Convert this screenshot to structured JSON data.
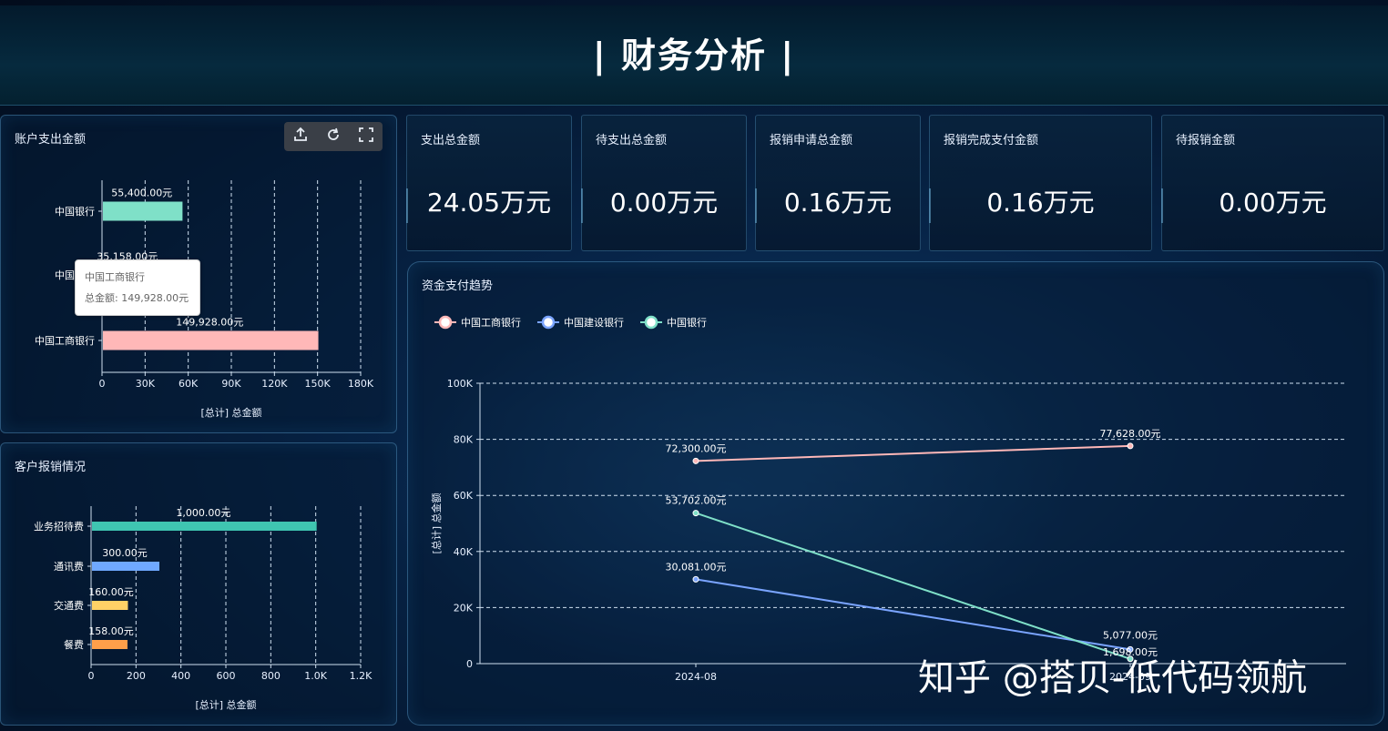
{
  "header": {
    "title": "| 财务分析 |"
  },
  "watermark": "知乎 @搭贝-低代码领航",
  "toolbar": {
    "icons": [
      "export-icon",
      "refresh-icon",
      "fullscreen-icon"
    ]
  },
  "colors": {
    "icbc": "#ffb8b8",
    "ccb": "#7aa4ff",
    "boc": "#7fe0c8",
    "bar1": "#3fc5b1",
    "bar2": "#6fa8ff",
    "bar3": "#ffd166",
    "bar4": "#ff9f4a"
  },
  "kpis": [
    {
      "label": "支出总金额",
      "value": "24.05万元"
    },
    {
      "label": "待支出总金额",
      "value": "0.00万元"
    },
    {
      "label": "报销申请总金额",
      "value": "0.16万元"
    },
    {
      "label": "报销完成支付金额",
      "value": "0.16万元"
    },
    {
      "label": "待报销金额",
      "value": "0.00万元"
    }
  ],
  "tooltip": {
    "title": "中国工商银行",
    "line": "总金额: 149,928.00元"
  },
  "chart_data": [
    {
      "type": "bar",
      "title": "账户支出金额",
      "orientation": "horizontal",
      "categories": [
        "中国银行",
        "中国建设银行",
        "中国工商银行"
      ],
      "category_labels": [
        "中国银行",
        "中国建设",
        "中国工商银行"
      ],
      "values": [
        55400,
        35158,
        149928
      ],
      "value_labels": [
        "55,400.00元",
        "35,158.00元",
        "149,928.00元"
      ],
      "xlim": [
        0,
        180000
      ],
      "xticks": [
        "0",
        "30K",
        "60K",
        "90K",
        "120K",
        "150K",
        "180K"
      ],
      "xlabel": "[总计] 总金额",
      "grid": true
    },
    {
      "type": "bar",
      "title": "客户报销情况",
      "orientation": "horizontal",
      "categories": [
        "业务招待费",
        "通讯费",
        "交通费",
        "餐费"
      ],
      "values": [
        1000,
        300,
        160,
        158
      ],
      "value_labels": [
        "1,000.00元",
        "300.00元",
        "160.00元",
        "158.00元"
      ],
      "xlim": [
        0,
        1200
      ],
      "xticks": [
        "0",
        "200",
        "400",
        "600",
        "800",
        "1.0K",
        "1.2K"
      ],
      "xlabel": "[总计] 总金额",
      "grid": true
    },
    {
      "type": "line",
      "title": "资金支付趋势",
      "x": [
        "2024-08",
        "2024-09"
      ],
      "series": [
        {
          "name": "中国工商银行",
          "values": [
            72300,
            77628
          ],
          "labels": [
            "72,300.00元",
            "77,628.00元"
          ]
        },
        {
          "name": "中国建设银行",
          "values": [
            30081,
            5077
          ],
          "labels": [
            "30,081.00元",
            "5,077.00元"
          ]
        },
        {
          "name": "中国银行",
          "values": [
            53702,
            1698
          ],
          "labels": [
            "53,702.00元",
            "1,698.00元"
          ]
        }
      ],
      "ylim": [
        0,
        100000
      ],
      "yticks": [
        "0",
        "20K",
        "40K",
        "60K",
        "80K",
        "100K"
      ],
      "ylabel": "[总计] 总金额",
      "legend": "top-left",
      "grid": true
    }
  ]
}
